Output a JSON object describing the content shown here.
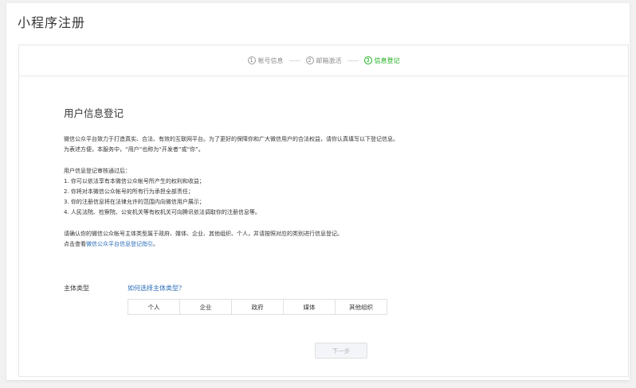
{
  "page": {
    "title": "小程序注册"
  },
  "steps": [
    {
      "num": "1",
      "label": "帐号信息",
      "active": false
    },
    {
      "num": "2",
      "label": "邮箱激活",
      "active": false
    },
    {
      "num": "3",
      "label": "信息登记",
      "active": true
    }
  ],
  "section": {
    "title": "用户信息登记",
    "intro_line1": "微信公众平台致力于打造真实、合法、有效的互联网平台。为了更好的保障你和广大微信用户的合法权益，请你认真填写以下登记信息。",
    "intro_line2": "为表述方便，本服务中，“用户”也称为“开发者”或“你”。",
    "list_title": "用户信息登记审核通过后：",
    "list": [
      "1. 你可以依法享有本微信公众帐号所产生的权利和收益；",
      "2. 你将对本微信公众帐号的所有行为承担全部责任；",
      "3. 你的注册信息将在法律允许的范围内向微信用户展示；",
      "4. 人民法院、检察院、公安机关等有权机关可向腾讯依法调取你的注册信息等。"
    ],
    "confirm_line": "请确认你的微信公众帐号主体类型属于政府、媒体、企业、其他组织、个人，并请按照对应的类别进行信息登记。",
    "guide_prefix": "点击查看",
    "guide_link": "微信公众平台信息登记指引",
    "guide_suffix": "。"
  },
  "subject": {
    "label": "主体类型",
    "help_link": "如何选择主体类型？",
    "types": [
      "个人",
      "企业",
      "政府",
      "媒体",
      "其他组织"
    ]
  },
  "buttons": {
    "next": "下一步"
  }
}
